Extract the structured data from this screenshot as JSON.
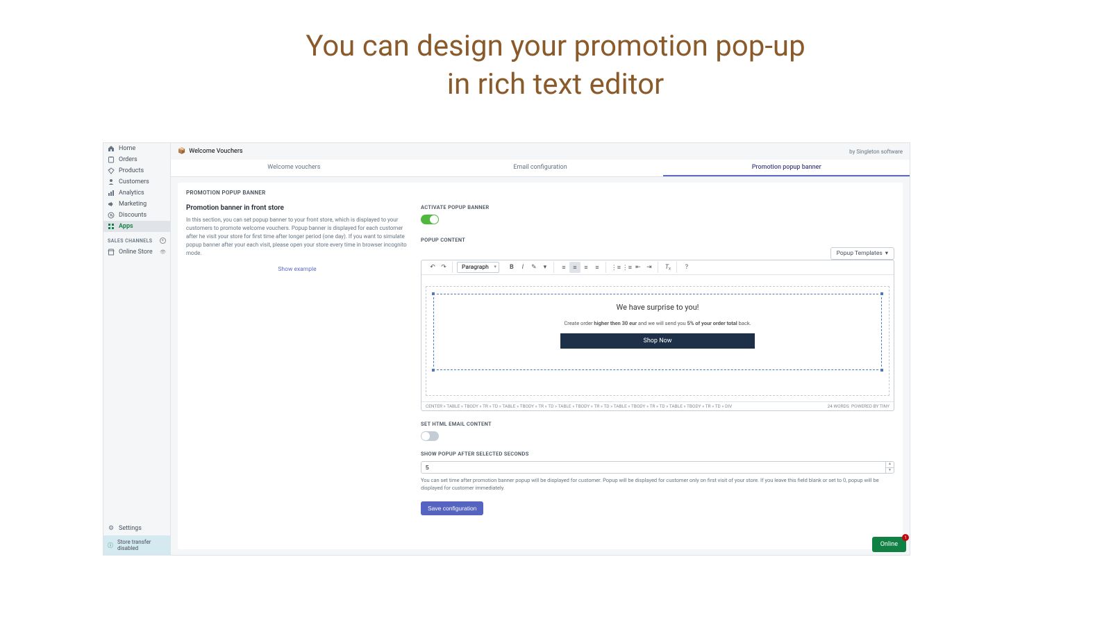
{
  "headline": "You can design your promotion pop-up\nin rich text editor",
  "app": {
    "name": "Welcome Vouchers",
    "author": "by Singleton software"
  },
  "nav": {
    "items": [
      {
        "label": "Home",
        "icon": "home"
      },
      {
        "label": "Orders",
        "icon": "orders"
      },
      {
        "label": "Products",
        "icon": "products"
      },
      {
        "label": "Customers",
        "icon": "customers"
      },
      {
        "label": "Analytics",
        "icon": "analytics"
      },
      {
        "label": "Marketing",
        "icon": "marketing"
      },
      {
        "label": "Discounts",
        "icon": "discounts"
      },
      {
        "label": "Apps",
        "icon": "apps"
      }
    ],
    "sales_channels": "SALES CHANNELS",
    "online_store": "Online Store",
    "settings": "Settings",
    "store_transfer": "Store transfer disabled"
  },
  "tabs": [
    {
      "label": "Welcome vouchers",
      "active": false
    },
    {
      "label": "Email configuration",
      "active": false
    },
    {
      "label": "Promotion popup banner",
      "active": true
    }
  ],
  "section_label": "PROMOTION POPUP BANNER",
  "left": {
    "title": "Promotion banner in front store",
    "desc": "In this section, you can set popup banner to your front store, which is displayed to your customers to promote welcome vouchers. Popup banner is displayed for each customer after he visit your store for first time after longer period (one day). If you want to simulate popup banner after your each visit, please open your store every time in browser incognito mode.",
    "show_example": "Show example"
  },
  "right": {
    "activate_label": "ACTIVATE POPUP BANNER",
    "popup_content_label": "POPUP CONTENT",
    "popup_templates": "Popup Templates",
    "paragraph": "Paragraph",
    "editor": {
      "title": "We have surprise to you!",
      "text_prefix": "Create order ",
      "text_bold1": "higher then 30 eur",
      "text_mid": " and we will send you ",
      "text_bold2": "5% of your order total",
      "text_suffix": " back.",
      "button": "Shop Now",
      "breadcrumb": "CENTER » TABLE » TBODY » TR » TD » TABLE » TBODY » TR » TD » TABLE » TBODY » TR » TD » TABLE » TBODY » TR » TD » TABLE » TBODY » TR » TD » DIV",
      "words": "24 WORDS",
      "powered": "POWERED BY TINY"
    },
    "set_html_label": "SET HTML EMAIL CONTENT",
    "seconds_label": "SHOW POPUP AFTER SELECTED SECONDS",
    "seconds_value": "5",
    "seconds_help": "You can set time after promotion banner popup will be displayed for customer. Popup will be displayed for customer only on first visit of your store. If you leave this field blank or set to 0, popup will be displayed for customer immediately.",
    "save": "Save configuration"
  },
  "online": {
    "label": "Online",
    "count": "1"
  }
}
